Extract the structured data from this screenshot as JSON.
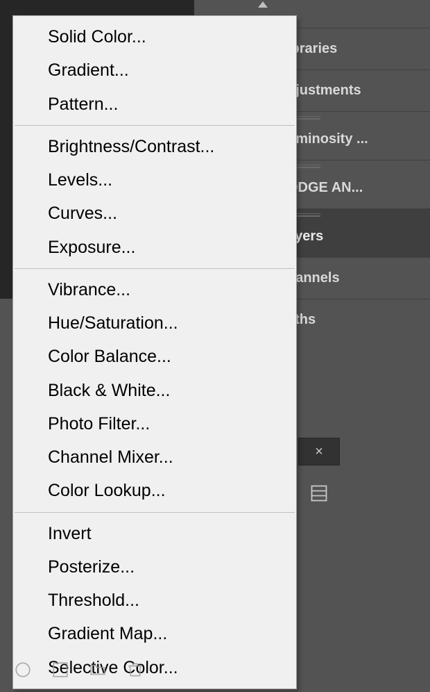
{
  "panels": {
    "libraries": "ibraries",
    "adjustments": "djustments",
    "luminosity": "uminosity ...",
    "dodge": "ODGE AN...",
    "layers": "ayers",
    "channels": "hannels",
    "paths": "aths"
  },
  "menu": {
    "group1": [
      {
        "label": "Solid Color..."
      },
      {
        "label": "Gradient..."
      },
      {
        "label": "Pattern..."
      }
    ],
    "group2": [
      {
        "label": "Brightness/Contrast..."
      },
      {
        "label": "Levels..."
      },
      {
        "label": "Curves..."
      },
      {
        "label": "Exposure..."
      }
    ],
    "group3": [
      {
        "label": "Vibrance..."
      },
      {
        "label": "Hue/Saturation..."
      },
      {
        "label": "Color Balance..."
      },
      {
        "label": "Black & White..."
      },
      {
        "label": "Photo Filter..."
      },
      {
        "label": "Channel Mixer..."
      },
      {
        "label": "Color Lookup..."
      }
    ],
    "group4": [
      {
        "label": "Invert"
      },
      {
        "label": "Posterize..."
      },
      {
        "label": "Threshold..."
      },
      {
        "label": "Gradient Map..."
      },
      {
        "label": "Selective Color..."
      }
    ]
  },
  "close": "×"
}
